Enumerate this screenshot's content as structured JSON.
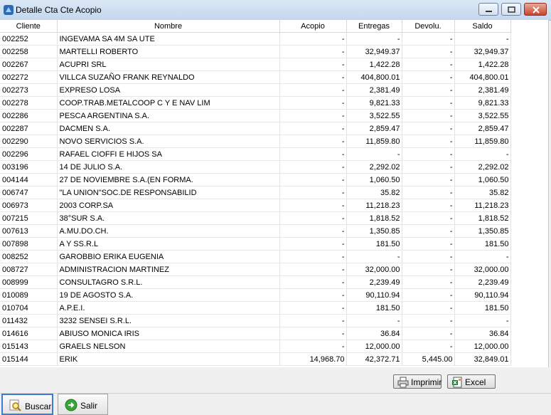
{
  "window": {
    "title": "Detalle Cta Cte Acopio"
  },
  "table": {
    "headers": [
      "Cliente",
      "Nombre",
      "Acopio",
      "Entregas",
      "Devolu.",
      "Saldo"
    ],
    "rows": [
      [
        "002252",
        "INGEVAMA SA  4M SA  UTE",
        "-",
        "-",
        "-",
        "-"
      ],
      [
        "002258",
        "MARTELLI ROBERTO",
        "-",
        "32,949.37",
        "-",
        "32,949.37"
      ],
      [
        "002267",
        "ACUPRI SRL",
        "-",
        "1,422.28",
        "-",
        "1,422.28"
      ],
      [
        "002272",
        "VILLCA SUZAÑO FRANK REYNALDO",
        "-",
        "404,800.01",
        "-",
        "404,800.01"
      ],
      [
        "002273",
        "EXPRESO LOSA",
        "-",
        "2,381.49",
        "-",
        "2,381.49"
      ],
      [
        "002278",
        "COOP.TRAB.METALCOOP C Y E NAV LIM",
        "-",
        "9,821.33",
        "-",
        "9,821.33"
      ],
      [
        "002286",
        "PESCA ARGENTINA S.A.",
        "-",
        "3,522.55",
        "-",
        "3,522.55"
      ],
      [
        "002287",
        "DACMEN S.A.",
        "-",
        "2,859.47",
        "-",
        "2,859.47"
      ],
      [
        "002290",
        "NOVO SERVICIOS S.A.",
        "-",
        "11,859.80",
        "-",
        "11,859.80"
      ],
      [
        "002296",
        "RAFAEL CIOFFI E HIJOS SA",
        "-",
        "-",
        "-",
        "-"
      ],
      [
        "003196",
        "14 DE JULIO S.A.",
        "-",
        "2,292.02",
        "-",
        "2,292.02"
      ],
      [
        "004144",
        "27 DE NOVIEMBRE S.A.(EN FORMA.",
        "-",
        "1,060.50",
        "-",
        "1,060.50"
      ],
      [
        "006747",
        "\"LA UNION\"SOC.DE RESPONSABILID",
        "-",
        "35.82",
        "-",
        "35.82"
      ],
      [
        "006973",
        "2003 CORP.SA",
        "-",
        "11,218.23",
        "-",
        "11,218.23"
      ],
      [
        "007215",
        "38°SUR S.A.",
        "-",
        "1,818.52",
        "-",
        "1,818.52"
      ],
      [
        "007613",
        "A.MU.DO.CH.",
        "-",
        "1,350.85",
        "-",
        "1,350.85"
      ],
      [
        "007898",
        "A Y SS.R.L",
        "-",
        "181.50",
        "-",
        "181.50"
      ],
      [
        "008252",
        "GAROBBIO ERIKA EUGENIA",
        "-",
        "-",
        "-",
        "-"
      ],
      [
        "008727",
        "ADMINISTRACION MARTINEZ",
        "-",
        "32,000.00",
        "-",
        "32,000.00"
      ],
      [
        "008999",
        "CONSULTAGRO S.R.L.",
        "-",
        "2,239.49",
        "-",
        "2,239.49"
      ],
      [
        "010089",
        "19 DE AGOSTO S.A.",
        "-",
        "90,110.94",
        "-",
        "90,110.94"
      ],
      [
        "010704",
        "A.P.E.I.",
        "-",
        "181.50",
        "-",
        "181.50"
      ],
      [
        "011432",
        "3232 SENSEI S.R.L.",
        "-",
        "-",
        "-",
        "-"
      ],
      [
        "014616",
        "ABIUSO MONICA IRIS",
        "-",
        "36.84",
        "-",
        "36.84"
      ],
      [
        "015143",
        "GRAELS NELSON",
        "-",
        "12,000.00",
        "-",
        "12,000.00"
      ],
      [
        "015144",
        "ERIK",
        "14,968.70",
        "42,372.71",
        "5,445.00",
        "32,849.01"
      ]
    ]
  },
  "buttons": {
    "print": "Imprimir",
    "excel": "Excel",
    "buscar": "Buscar",
    "salir": "Salir"
  },
  "colors": {
    "titlebar": "#c4d7ee",
    "close": "#c8442d",
    "focus": "#3d7bd8",
    "salir_icon": "#3aa53a"
  },
  "icons": [
    "app-icon",
    "minimize-icon",
    "maximize-icon",
    "close-icon",
    "printer-icon",
    "excel-icon",
    "search-icon",
    "exit-arrow-icon"
  ]
}
